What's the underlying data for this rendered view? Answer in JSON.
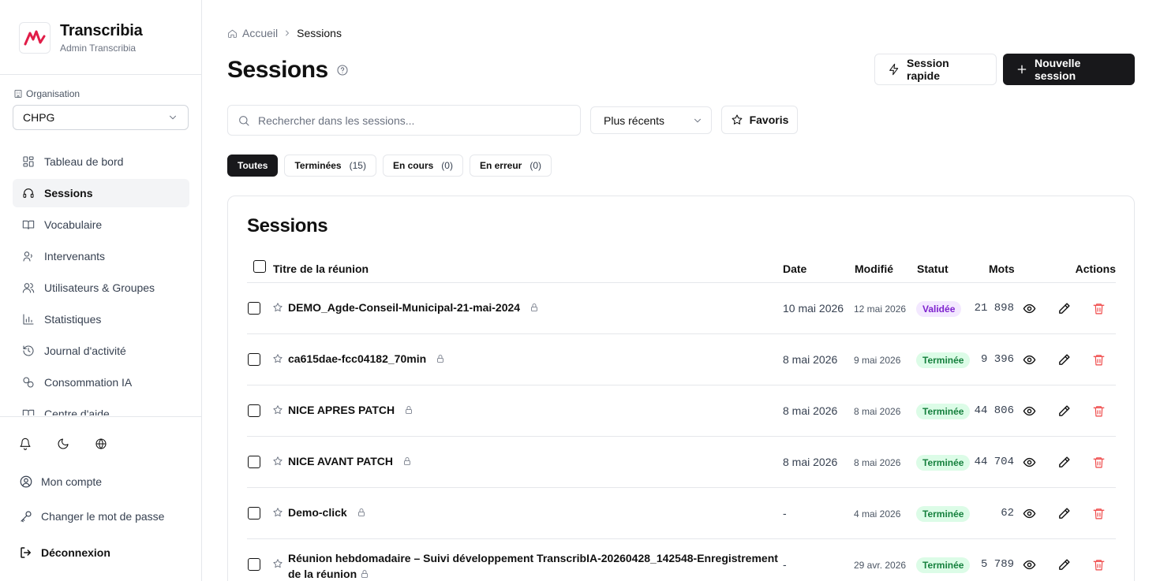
{
  "brand": {
    "name": "Transcribia",
    "subtitle": "Admin Transcribia"
  },
  "organisation": {
    "label": "Organisation",
    "selected": "CHPG"
  },
  "nav": [
    {
      "label": "Tableau de bord",
      "icon": "dashboard-icon",
      "active": false
    },
    {
      "label": "Sessions",
      "icon": "sessions-icon",
      "active": true
    },
    {
      "label": "Vocabulaire",
      "icon": "book-icon",
      "active": false
    },
    {
      "label": "Intervenants",
      "icon": "speaker-icon",
      "active": false
    },
    {
      "label": "Utilisateurs & Groupes",
      "icon": "users-icon",
      "active": false
    },
    {
      "label": "Statistiques",
      "icon": "chart-icon",
      "active": false
    },
    {
      "label": "Journal d'activité",
      "icon": "history-icon",
      "active": false
    },
    {
      "label": "Consommation IA",
      "icon": "ai-usage-icon",
      "active": false
    },
    {
      "label": "Centre d'aide",
      "icon": "help-book-icon",
      "active": false
    }
  ],
  "footer": {
    "account": "Mon compte",
    "password": "Changer le mot de passe",
    "logout": "Déconnexion"
  },
  "breadcrumb": {
    "home": "Accueil",
    "current": "Sessions"
  },
  "page": {
    "title": "Sessions",
    "quick_session": "Session rapide",
    "new_session": "Nouvelle session"
  },
  "search": {
    "placeholder": "Rechercher dans les sessions...",
    "value": ""
  },
  "sort": {
    "selected": "Plus récents"
  },
  "favorites_label": "Favoris",
  "tabs": [
    {
      "label": "Toutes",
      "count": "",
      "active": true
    },
    {
      "label": "Terminées",
      "count": "(15)",
      "active": false
    },
    {
      "label": "En cours",
      "count": "(0)",
      "active": false
    },
    {
      "label": "En erreur",
      "count": "(0)",
      "active": false
    }
  ],
  "table": {
    "title": "Sessions",
    "columns": {
      "title": "Titre de la réunion",
      "date": "Date",
      "modified": "Modifié",
      "status": "Statut",
      "words": "Mots",
      "actions": "Actions"
    },
    "rows": [
      {
        "title": "DEMO_Agde-Conseil-Municipal-21-mai-2024",
        "date": "10 mai 2026",
        "modified": "12 mai 2026",
        "status": "Validée",
        "words": "21 898"
      },
      {
        "title": "ca615dae-fcc04182_70min",
        "date": "8 mai 2026",
        "modified": "9 mai 2026",
        "status": "Terminée",
        "words": "9 396"
      },
      {
        "title": "NICE APRES PATCH",
        "date": "8 mai 2026",
        "modified": "8 mai 2026",
        "status": "Terminée",
        "words": "44 806"
      },
      {
        "title": "NICE AVANT PATCH",
        "date": "8 mai 2026",
        "modified": "8 mai 2026",
        "status": "Terminée",
        "words": "44 704"
      },
      {
        "title": "Demo-click",
        "date": "-",
        "modified": "4 mai 2026",
        "status": "Terminée",
        "words": "62"
      },
      {
        "title": "Réunion hebdomadaire – Suivi développement TranscribIA-20260428_142548-Enregistrement de la réunion",
        "date": "-",
        "modified": "29 avr. 2026",
        "status": "Terminée",
        "words": "5 789"
      }
    ]
  },
  "colors": {
    "accent": "#18181b",
    "done_bg": "#dcfce7",
    "done_fg": "#15803d",
    "valid_bg": "#f3e8ff",
    "valid_fg": "#7e22ce",
    "delete": "#ef4444",
    "logo": "#e11d48"
  }
}
